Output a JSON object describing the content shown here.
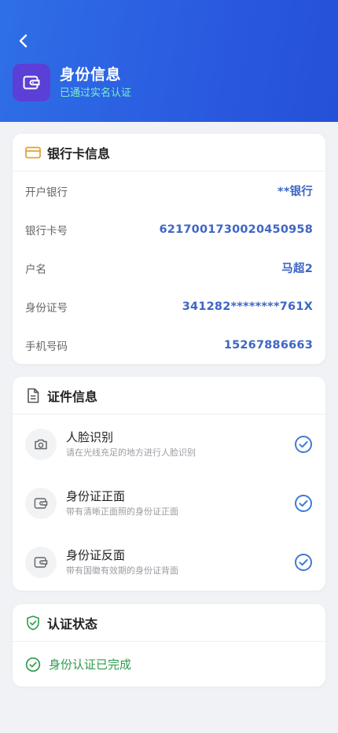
{
  "header": {
    "title": "身份信息",
    "subtitle": "已通过实名认证",
    "back_icon": "chevron-left-icon",
    "tile_icon": "wallet-icon"
  },
  "bank_card": {
    "title": "银行卡信息",
    "icon": "credit-card-icon",
    "rows": [
      {
        "label": "开户银行",
        "value": "**银行"
      },
      {
        "label": "银行卡号",
        "value": "6217001730020450958"
      },
      {
        "label": "户名",
        "value": "马超2"
      },
      {
        "label": "身份证号",
        "value": "341282********761X"
      },
      {
        "label": "手机号码",
        "value": "15267886663"
      }
    ]
  },
  "documents": {
    "title": "证件信息",
    "icon": "document-icon",
    "items": [
      {
        "title": "人脸识别",
        "desc": "请在光线充足的地方进行人脸识别",
        "icon": "camera-icon"
      },
      {
        "title": "身份证正面",
        "desc": "带有清晰正面照的身份证正面",
        "icon": "wallet-icon"
      },
      {
        "title": "身份证反面",
        "desc": "带有国徽有效期的身份证背面",
        "icon": "wallet-icon"
      }
    ]
  },
  "status": {
    "title": "认证状态",
    "icon": "shield-check-icon",
    "text": "身份认证已完成"
  },
  "colors": {
    "header_gradient_start": "#2f6fe6",
    "header_gradient_end": "#2550d8",
    "subtitle": "#7ef0cf",
    "value_blue": "#3f66c4",
    "check_blue": "#3f7bd6",
    "success_green": "#2e9a4a",
    "bank_icon_gold": "#e0a23a",
    "tile_purple": "#5b3fd6"
  }
}
